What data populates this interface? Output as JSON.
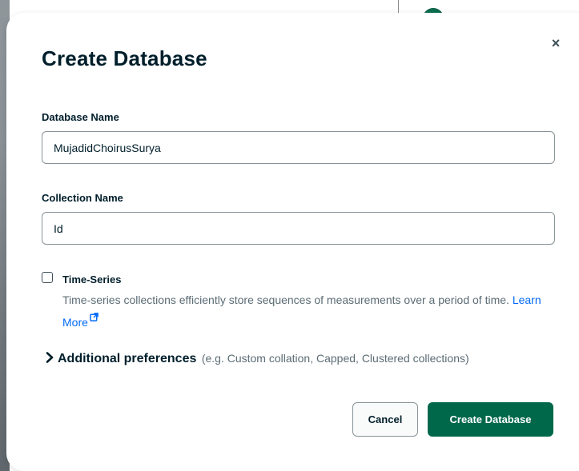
{
  "dialog": {
    "title": "Create Database",
    "close_label": "×",
    "database_name": {
      "label": "Database Name",
      "value": "MujadidChoirusSurya"
    },
    "collection_name": {
      "label": "Collection Name",
      "value": "Id"
    },
    "time_series": {
      "checked": false,
      "label": "Time-Series",
      "description": "Time-series collections efficiently store sequences of measurements over a period of time.",
      "link_label": "Learn More",
      "link_icon": "external-link-icon"
    },
    "additional_preferences": {
      "title": "Additional preferences",
      "hint": "(e.g. Custom collation, Capped, Clustered collections)",
      "icon": "chevron-right-icon"
    },
    "buttons": {
      "cancel": "Cancel",
      "create": "Create Database"
    }
  },
  "colors": {
    "primary_button": "#00684a",
    "link": "#016bf8",
    "text_dark": "#001e2b",
    "text_muted": "#5c6c75"
  }
}
